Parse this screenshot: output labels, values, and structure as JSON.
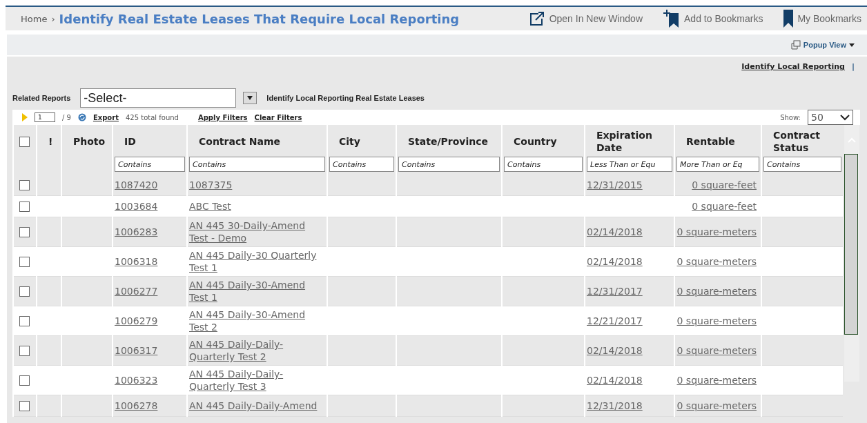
{
  "header": {
    "home": "Home",
    "separator": "›",
    "title": "Identify Real Estate Leases That Require Local Reporting",
    "actions": [
      {
        "kind": "open-window",
        "label": "Open In New Window"
      },
      {
        "kind": "add-bookmark",
        "label": "Add to Bookmarks"
      },
      {
        "kind": "bookmarks",
        "label": "My Bookmarks"
      }
    ]
  },
  "popup_view": "Popup View",
  "report_links": [
    {
      "label": "Identify Local Reporting"
    }
  ],
  "report_links_separator": "|",
  "related_reports": {
    "label": "Related Reports",
    "value": "-Select-",
    "report_title": "Identify Local Reporting Real Estate Leases"
  },
  "toolbar": {
    "page": "1",
    "total_pages": "/ 9",
    "export": "Export",
    "found": "425 total found",
    "apply_filters": "Apply Filters",
    "clear_filters": "Clear Filters",
    "show_label": "Show:",
    "show_value": "50"
  },
  "table": {
    "select_all_checked": false,
    "columns": [
      {
        "kind": "check"
      },
      {
        "kind": "text",
        "label": "!"
      },
      {
        "kind": "text",
        "label": "Photo"
      },
      {
        "kind": "text",
        "label": "ID",
        "placeholder": "Contains"
      },
      {
        "kind": "text",
        "label": "Contract Name",
        "placeholder": "Contains"
      },
      {
        "kind": "text",
        "label": "City",
        "placeholder": "Contains"
      },
      {
        "kind": "text",
        "label": "State/Province",
        "placeholder": "Contains"
      },
      {
        "kind": "text",
        "label": "Country",
        "placeholder": "Contains"
      },
      {
        "kind": "text",
        "label": "Expiration Date",
        "placeholder": "Less Than or Equ"
      },
      {
        "kind": "right",
        "label": "Rentable",
        "placeholder": "More Than or Eq"
      },
      {
        "kind": "text",
        "label": "Contract Status",
        "placeholder": "Contains"
      }
    ],
    "rows": [
      {
        "checked": false,
        "id": "1087420",
        "contract_name": "1087375",
        "expiration_date": "12/31/2015",
        "rentable": "0 square-feet"
      },
      {
        "checked": false,
        "id": "1003684",
        "contract_name": "ABC Test",
        "rentable": "0 square-feet"
      },
      {
        "checked": false,
        "id": "1006283",
        "contract_name": "AN 445 30-Daily-Amend Test - Demo",
        "expiration_date": "02/14/2018",
        "rentable": "0 square-meters"
      },
      {
        "checked": false,
        "id": "1006318",
        "contract_name": "AN 445 Daily-30 Quarterly Test 1",
        "expiration_date": "02/14/2018",
        "rentable": "0 square-meters"
      },
      {
        "checked": false,
        "id": "1006277",
        "contract_name": "AN 445 Daily-30-Amend Test 1",
        "expiration_date": "12/31/2017",
        "rentable": "0 square-meters"
      },
      {
        "checked": false,
        "id": "1006279",
        "contract_name": "AN 445 Daily-30-Amend Test 2",
        "expiration_date": "12/21/2017",
        "rentable": "0 square-meters"
      },
      {
        "checked": false,
        "id": "1006317",
        "contract_name": "AN 445 Daily-Daily-Quarterly Test 2",
        "expiration_date": "02/14/2018",
        "rentable": "0 square-meters"
      },
      {
        "checked": false,
        "id": "1006323",
        "contract_name": "AN 445 Daily-Daily-Quarterly Test 3",
        "expiration_date": "02/14/2018",
        "rentable": "0 square-meters"
      },
      {
        "checked": false,
        "id": "1006278",
        "contract_name": "AN 445 Daily-Daily-Amend",
        "expiration_date": "12/31/2018",
        "rentable": "0 square-meters"
      }
    ]
  }
}
